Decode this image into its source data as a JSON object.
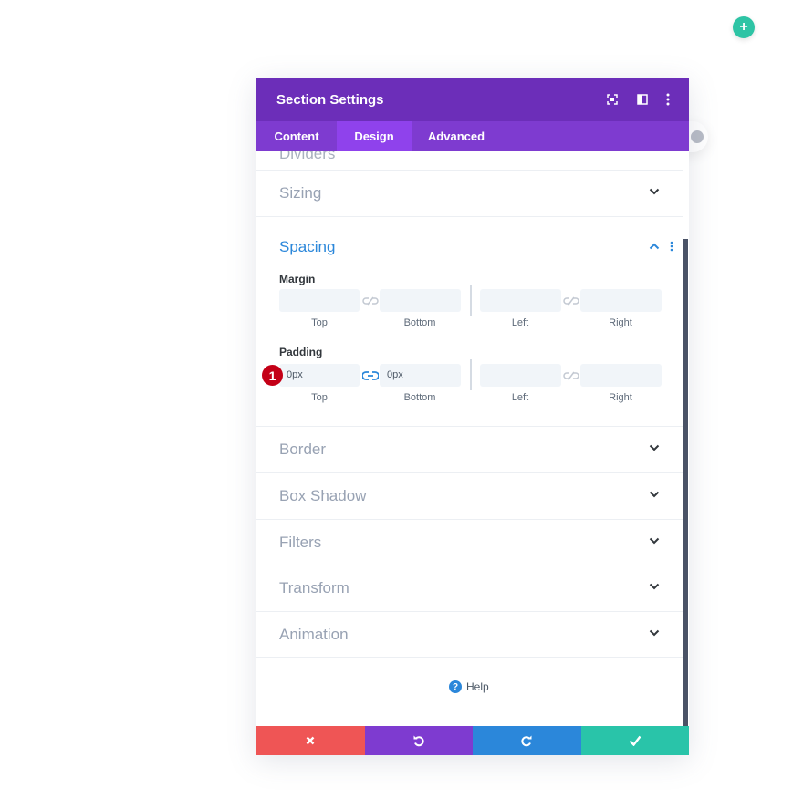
{
  "modal": {
    "title": "Section Settings",
    "tabs": [
      {
        "label": "Content",
        "active": false
      },
      {
        "label": "Design",
        "active": true
      },
      {
        "label": "Advanced",
        "active": false
      }
    ],
    "partial_section_title": "Dividers"
  },
  "sections": {
    "sizing": "Sizing",
    "spacing": "Spacing",
    "border": "Border",
    "box_shadow": "Box Shadow",
    "filters": "Filters",
    "transform": "Transform",
    "animation": "Animation"
  },
  "spacing": {
    "margin": {
      "label": "Margin",
      "top": {
        "value": "",
        "label": "Top"
      },
      "bottom": {
        "value": "",
        "label": "Bottom"
      },
      "left": {
        "value": "",
        "label": "Left"
      },
      "right": {
        "value": "",
        "label": "Right"
      }
    },
    "padding": {
      "label": "Padding",
      "top": {
        "value": "0px",
        "label": "Top"
      },
      "bottom": {
        "value": "0px",
        "label": "Bottom"
      },
      "left": {
        "value": "",
        "label": "Left"
      },
      "right": {
        "value": "",
        "label": "Right"
      }
    }
  },
  "badge": "1",
  "help_label": "Help",
  "colors": {
    "header": "#6c2eb9",
    "tabs": "#7e3bd0",
    "tab_active": "#8f42ec",
    "cancel": "#ef5555",
    "undo": "#7e3bd0",
    "redo": "#2b87da",
    "save": "#29c4a9",
    "accent_teal": "#2ec4a5"
  }
}
